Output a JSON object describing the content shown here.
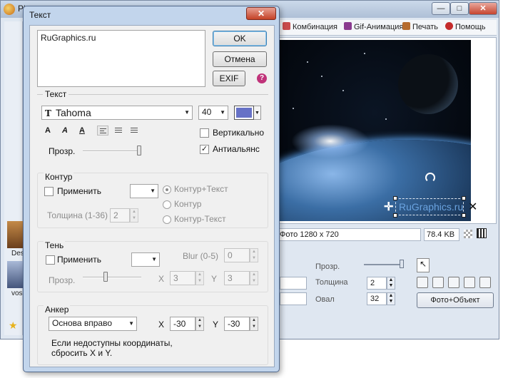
{
  "main_window": {
    "title": "Ph",
    "toolbar": [
      {
        "label": "Комбинация",
        "icon": "combination-icon",
        "color": "#c94c4c"
      },
      {
        "label": "Gif-Анимация",
        "icon": "gif-animation-icon",
        "color": "#8a3a8f"
      },
      {
        "label": "Печать",
        "icon": "print-icon",
        "color": "#b56b2e"
      },
      {
        "label": "Помощь",
        "icon": "help-icon",
        "color": "#c42b2b"
      }
    ],
    "canvas_text": "RuGraphics.ru",
    "status_photo": "Фото 1280 x 720",
    "status_size": "78.4 KB",
    "thumbnails": [
      "Des",
      "vos"
    ],
    "lower": {
      "opacity_label": "Прозр.",
      "thickness_label": "Толщина",
      "thickness_value": "2",
      "oval_label": "Овал",
      "oval_value": "32",
      "photo_object_button": "Фото+Объект"
    }
  },
  "dialog": {
    "title": "Текст",
    "close_label": "✕",
    "text_value": "RuGraphics.ru",
    "ok_label": "OK",
    "cancel_label": "Отмена",
    "exif_label": "EXIF",
    "help_label": "?",
    "text_section": {
      "title": "Текст",
      "font_name": "Tahoma",
      "font_size": "40",
      "color": "#6671c6",
      "vertical_label": "Вертикально",
      "vertical_checked": false,
      "antialias_label": "Антиальянс",
      "antialias_checked": true,
      "opacity_label": "Прозр.",
      "opacity_level": 1.0
    },
    "contour_section": {
      "title": "Контур",
      "apply_label": "Применить",
      "apply_checked": false,
      "thickness_label": "Толщина (1-36)",
      "thickness_value": "2",
      "radio_options": [
        "Контур+Текст",
        "Контур",
        "Контур-Текст"
      ],
      "radio_selected": "Контур+Текст"
    },
    "shadow_section": {
      "title": "Тень",
      "apply_label": "Применить",
      "apply_checked": false,
      "blur_label": "Blur (0-5)",
      "blur_value": "0",
      "opacity_label": "Прозр.",
      "opacity_level": 0.38,
      "x_label": "X",
      "x_value": "3",
      "y_label": "Y",
      "y_value": "3"
    },
    "anchor_section": {
      "title": "Анкер",
      "anchor_value": "Основа вправо",
      "x_label": "X",
      "x_value": "-30",
      "y_label": "Y",
      "y_value": "-30",
      "note": "Если недоступны координаты, сбросить X и Y."
    }
  }
}
